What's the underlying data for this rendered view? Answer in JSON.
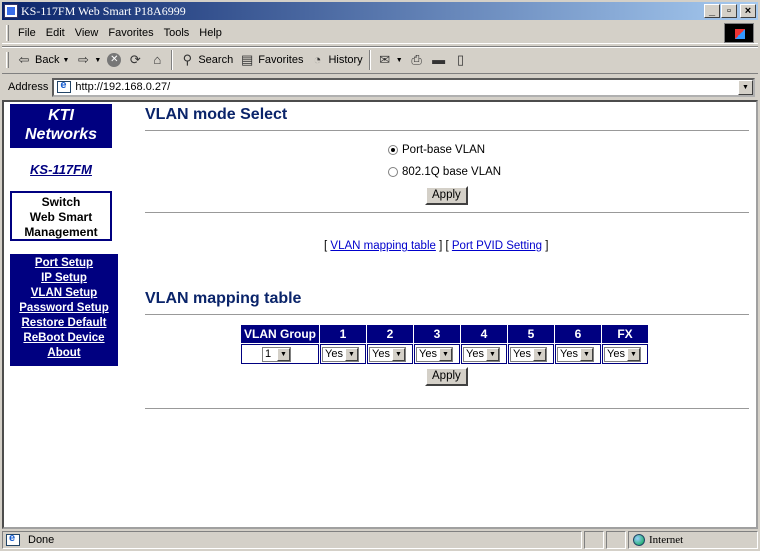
{
  "window": {
    "title": "KS-117FM Web Smart P18A6999"
  },
  "menu": [
    "File",
    "Edit",
    "View",
    "Favorites",
    "Tools",
    "Help"
  ],
  "toolbar": {
    "back": "Back",
    "search": "Search",
    "favorites": "Favorites",
    "history": "History"
  },
  "address": {
    "label": "Address",
    "url": "http://192.168.0.27/"
  },
  "sidebar": {
    "logo_line1": "KTI",
    "logo_line2": "Networks",
    "model": "KS-117FM",
    "mgmt_line1": "Switch",
    "mgmt_line2": "Web Smart",
    "mgmt_line3": "Management",
    "nav": [
      "Port Setup",
      "IP Setup",
      "VLAN Setup",
      "Password Setup",
      "Restore Default",
      "ReBoot Device",
      "About"
    ]
  },
  "vlan_mode": {
    "title": "VLAN mode Select",
    "options": [
      {
        "label": "Port-base VLAN",
        "selected": true
      },
      {
        "label": "802.1Q base VLAN",
        "selected": false
      }
    ],
    "apply": "Apply"
  },
  "links": {
    "open1": "[",
    "mapping": "VLAN mapping table",
    "mid": "] [",
    "pvid": "Port PVID Setting",
    "close": "]"
  },
  "mapping": {
    "title": "VLAN mapping table",
    "headers": [
      "VLAN Group",
      "1",
      "2",
      "3",
      "4",
      "5",
      "6",
      "FX"
    ],
    "group_value": "1",
    "port_values": [
      "Yes",
      "Yes",
      "Yes",
      "Yes",
      "Yes",
      "Yes",
      "Yes"
    ],
    "apply": "Apply"
  },
  "status": {
    "text": "Done",
    "zone": "Internet"
  }
}
